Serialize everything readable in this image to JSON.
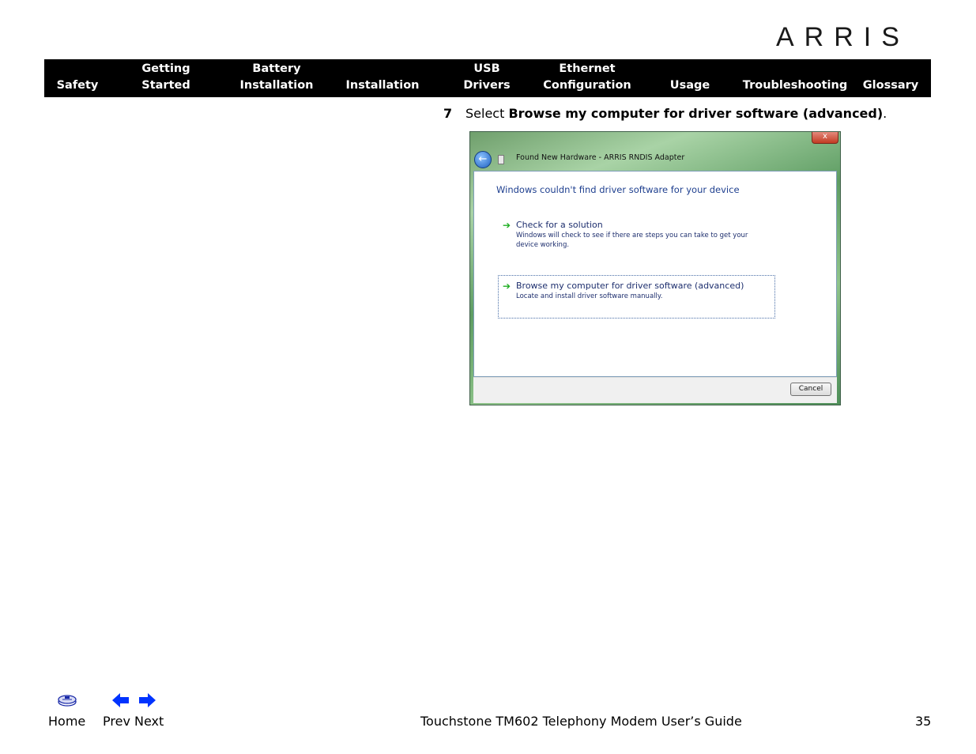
{
  "brand": {
    "logo_text": "ARRIS"
  },
  "nav": {
    "items": [
      {
        "line1": "",
        "line2": "Safety"
      },
      {
        "line1": "Getting",
        "line2": "Started"
      },
      {
        "line1": "Battery",
        "line2": "Installation"
      },
      {
        "line1": "",
        "line2": "Installation"
      },
      {
        "line1": "USB",
        "line2": "Drivers"
      },
      {
        "line1": "Ethernet",
        "line2": "Configuration"
      },
      {
        "line1": "",
        "line2": "Usage"
      },
      {
        "line1": "",
        "line2": "Troubleshooting"
      },
      {
        "line1": "",
        "line2": "Glossary"
      }
    ]
  },
  "step": {
    "number": "7",
    "prefix": "Select ",
    "bold": "Browse my computer for driver software (advanced)",
    "suffix": "."
  },
  "dialog": {
    "close_label": "x",
    "back_label": "←",
    "title": "Found New Hardware - ARRIS RNDIS Adapter",
    "heading": "Windows couldn't find driver software for your device",
    "options": [
      {
        "arrow": "➔",
        "title": "Check for a solution",
        "desc": "Windows will check to see if there are steps you can take to get your device working."
      },
      {
        "arrow": "➔",
        "title": "Browse my computer for driver software (advanced)",
        "desc": "Locate and install driver software manually."
      }
    ],
    "cancel_label": "Cancel"
  },
  "footer": {
    "home_label": "Home",
    "prev_label": "Prev",
    "next_label": "Next",
    "doc_title": "Touchstone TM602 Telephony Modem User’s Guide",
    "page_number": "35"
  }
}
